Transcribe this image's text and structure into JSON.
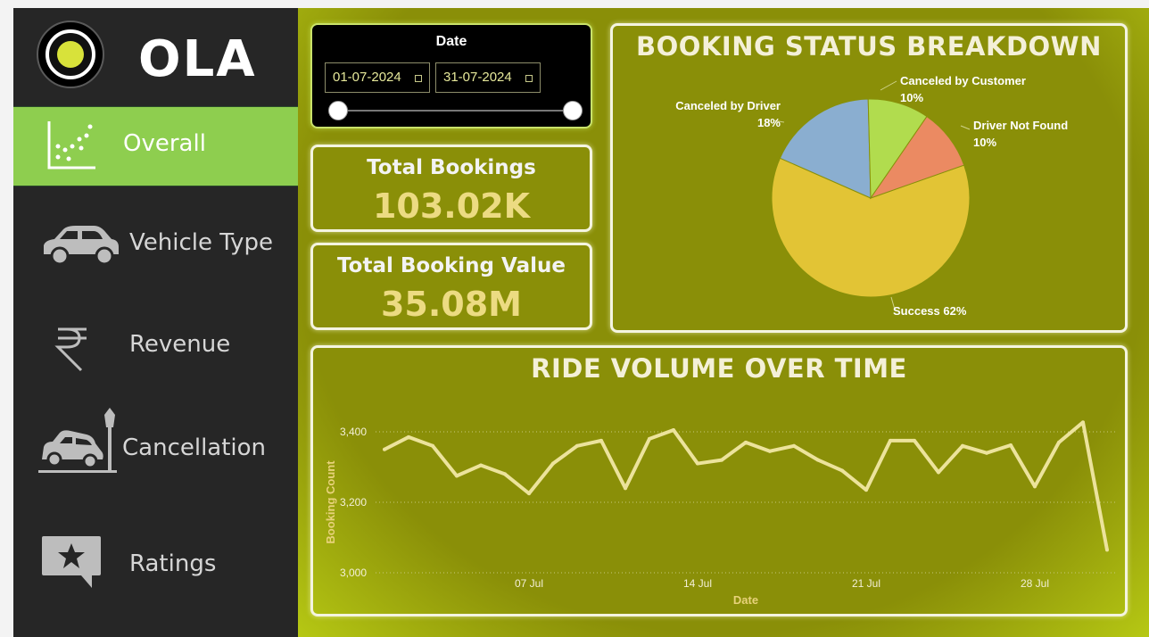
{
  "brand": {
    "name": "OLA"
  },
  "colors": {
    "sidebar_bg": "#262626",
    "active_nav_bg": "#8ece4f",
    "main_bg": "#8a8f08",
    "kpi_value": "#ecdb82",
    "line": "#ece39c"
  },
  "sidebar": {
    "items": [
      {
        "label": "Overall",
        "icon": "scatter-chart-icon",
        "active": true
      },
      {
        "label": "Vehicle Type",
        "icon": "car-icon",
        "active": false
      },
      {
        "label": "Revenue",
        "icon": "rupee-icon",
        "active": false
      },
      {
        "label": "Cancellation",
        "icon": "car-crash-icon",
        "active": false
      },
      {
        "label": "Ratings",
        "icon": "star-rating-icon",
        "active": false
      }
    ]
  },
  "date_filter": {
    "title": "Date",
    "start": "01-07-2024",
    "end": "31-07-2024",
    "start_icon": "calendar-icon",
    "end_icon": "calendar-icon"
  },
  "kpis": {
    "total_bookings": {
      "title": "Total Bookings",
      "value": "103.02K"
    },
    "total_booking_value": {
      "title": "Total Booking Value",
      "value": "35.08M"
    }
  },
  "booking_status": {
    "title": "BOOKING STATUS BREAKDOWN",
    "labels": {
      "canceled_by_customer": {
        "name": "Canceled by Customer",
        "pct": "10%"
      },
      "canceled_by_driver": {
        "name": "Canceled by Driver",
        "pct": "18%"
      },
      "driver_not_found": {
        "name": "Driver Not Found",
        "pct": "10%"
      },
      "success": {
        "name": "Success 62%"
      }
    }
  },
  "ride_volume": {
    "title": "RIDE VOLUME OVER TIME"
  },
  "chart_data": [
    {
      "type": "pie",
      "title": "BOOKING STATUS BREAKDOWN",
      "slices": [
        {
          "name": "Success",
          "value": 62,
          "color": "#e2c435"
        },
        {
          "name": "Canceled by Driver",
          "value": 18,
          "color": "#8aaed0"
        },
        {
          "name": "Canceled by Customer",
          "value": 10,
          "color": "#b1dc4e"
        },
        {
          "name": "Driver Not Found",
          "value": 10,
          "color": "#eb8a62"
        }
      ]
    },
    {
      "type": "line",
      "title": "RIDE VOLUME OVER TIME",
      "xlabel": "Date",
      "ylabel": "Booking Count",
      "ylim": [
        3000,
        3400
      ],
      "yticks": [
        3000,
        3200,
        3400
      ],
      "ytick_labels": [
        "3,000",
        "3,200",
        "3,400"
      ],
      "xticks": [
        7,
        14,
        21,
        28
      ],
      "xtick_labels": [
        "07 Jul",
        "14 Jul",
        "21 Jul",
        "28 Jul"
      ],
      "grid": true,
      "x": [
        1,
        2,
        3,
        4,
        5,
        6,
        7,
        8,
        9,
        10,
        11,
        12,
        13,
        14,
        15,
        16,
        17,
        18,
        19,
        20,
        21,
        22,
        23,
        24,
        25,
        26,
        27,
        28,
        29,
        30,
        31
      ],
      "series": [
        {
          "values": [
            3350,
            3385,
            3360,
            3275,
            3305,
            3280,
            3225,
            3310,
            3360,
            3375,
            3240,
            3380,
            3405,
            3310,
            3320,
            3370,
            3345,
            3360,
            3320,
            3290,
            3235,
            3375,
            3375,
            3285,
            3360,
            3340,
            3362,
            3245,
            3370,
            3427,
            3065
          ]
        }
      ]
    }
  ]
}
